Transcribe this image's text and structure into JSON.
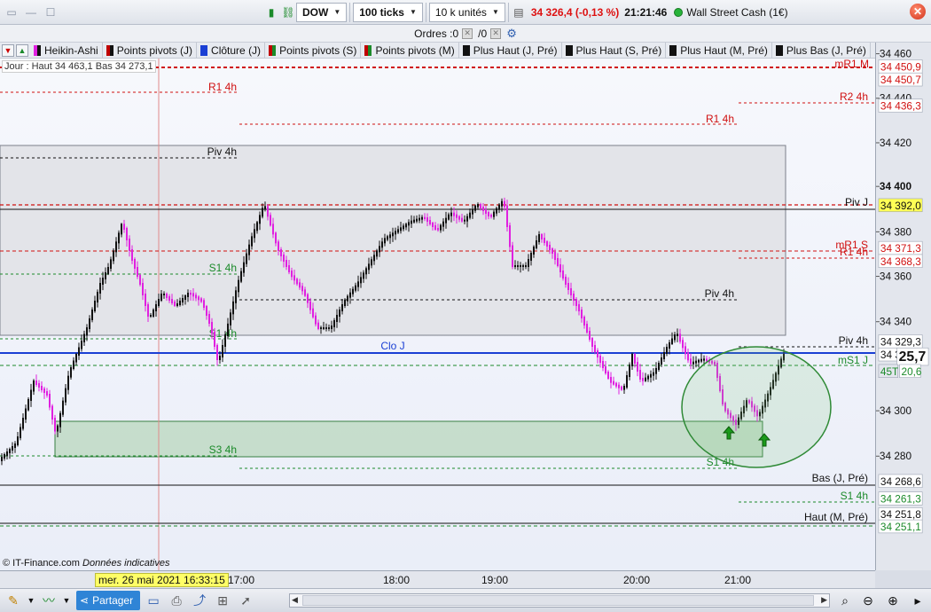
{
  "toolbar": {
    "instrument": "DOW",
    "ticks": "100 ticks",
    "units": "10 k unités",
    "price": "34 326,4 (-0,13 %)",
    "time": "21:21:46",
    "market": "Wall Street Cash (1€)"
  },
  "orders": {
    "label": "Ordres : ",
    "count1": "0",
    "slash": "/ ",
    "count2": "0"
  },
  "legend": [
    {
      "label": "Heikin-Ashi",
      "color": "#e020e0",
      "color2": "#111111"
    },
    {
      "label": "Points pivots (J)",
      "color": "#c00000",
      "color2": "#111111"
    },
    {
      "label": "Clôture (J)",
      "color": "#1a3fd4",
      "color2": ""
    },
    {
      "label": "Points pivots (S)",
      "color": "#c00000",
      "color2": "#1b8a2a"
    },
    {
      "label": "Points pivots (M)",
      "color": "#c00000",
      "color2": "#1b8a2a"
    },
    {
      "label": "Plus Haut (J, Pré)",
      "color": "#111111",
      "color2": ""
    },
    {
      "label": "Plus Haut (S, Pré)",
      "color": "#111111",
      "color2": ""
    },
    {
      "label": "Plus Haut (M, Pré)",
      "color": "#111111",
      "color2": ""
    },
    {
      "label": "Plus Bas (J, Pré)",
      "color": "#111111",
      "color2": ""
    }
  ],
  "info_box": "Jour : Haut 34 463,1 Bas 34 273,1",
  "price_axis": {
    "ticks": [
      "34 460",
      "34 440",
      "34 420",
      "34 400",
      "34 380",
      "34 360",
      "34 340",
      "34 300",
      "34 280"
    ],
    "bold_tick": "34 400",
    "tags": [
      {
        "text": "34 450,9",
        "color": "#d01010",
        "bg": "#ffffff"
      },
      {
        "text": "34 450,7",
        "color": "#d01010",
        "bg": "#ffffff"
      },
      {
        "text": "34 436,3",
        "color": "#d01010",
        "bg": "#ffffff"
      },
      {
        "text": "34 392,0",
        "color": "#111111",
        "bg": "#ffff55"
      },
      {
        "text": "34 371,3",
        "color": "#d01010",
        "bg": "#ffffff"
      },
      {
        "text": "34 368,3",
        "color": "#d01010",
        "bg": "#ffffff"
      },
      {
        "text": "34 329,3",
        "color": "#111111",
        "bg": "#ffffff"
      },
      {
        "text": "34 3",
        "color": "#111111",
        "bg": "#ffffff"
      },
      {
        "text": "25,7",
        "color": "#111111",
        "bg": "#ffffff"
      },
      {
        "text": "45T",
        "color": "#1b8a2a",
        "bg": "#e3e6ed"
      },
      {
        "text": "20,6",
        "color": "#1b8a2a",
        "bg": "#ffffff"
      },
      {
        "text": "34 268,6",
        "color": "#111111",
        "bg": "#ffffff"
      },
      {
        "text": "34 261,3",
        "color": "#1b8a2a",
        "bg": "#ffffff"
      },
      {
        "text": "34 251,8",
        "color": "#111111",
        "bg": "#ffffff"
      },
      {
        "text": "34 251,1",
        "color": "#1b8a2a",
        "bg": "#ffffff"
      }
    ]
  },
  "levels": {
    "r1_4h_left": "R1 4h",
    "mr1_m": "mR1 M",
    "r2_4h": "R2 4h",
    "r1_4h_mid": "R1 4h",
    "piv_4h_left": "Piv 4h",
    "piv_j": "Piv J",
    "mr1_s": "mR1 S",
    "r1_4h_right": "R1 4h",
    "s1_4h_a": "S1 4h",
    "piv_4h_mid": "Piv 4h",
    "s1_4h_b": "S1 4h",
    "clo_j": "Clo J",
    "piv_4h_right": "Piv 4h",
    "ms1_j": "mS1 J",
    "s3_4h": "S3 4h",
    "s1_4h_c": "S1 4h",
    "bas_j_pre": "Bas (J, Pré)",
    "s1_4h_d": "S1 4h",
    "haut_m_pre": "Haut (M, Pré)"
  },
  "time_axis": {
    "cursor": "mer. 26 mai 2021 16:33:15",
    "labels": [
      "17:00",
      "18:00",
      "19:00",
      "20:00",
      "21:00"
    ]
  },
  "footer": {
    "brand": "© IT-Finance.com ",
    "note": "Données indicatives"
  },
  "bottom": {
    "share": "Partager"
  },
  "colors": {
    "bull": "#111111",
    "bear": "#e020e0",
    "accent": "#2f84d6"
  }
}
